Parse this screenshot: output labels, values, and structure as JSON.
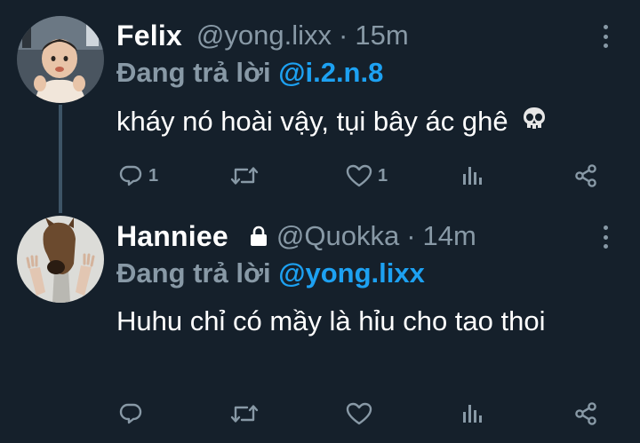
{
  "tweets": [
    {
      "name": "Felix",
      "handle": "@yong.lixx",
      "separator": "·",
      "time": "15m",
      "replying_prefix": "Đang trả lời",
      "replying_to": "@i.2.n.8",
      "text": "kháy nó hoài vậy, tụi bây ác ghê",
      "emoji": "💀",
      "reply_count": "1",
      "retweet_count": "",
      "like_count": "1",
      "locked": false,
      "avatar": "baby-photo"
    },
    {
      "name": "Hanniee",
      "handle": "@Quokka",
      "separator": "·",
      "time": "14m",
      "replying_prefix": "Đang trả lời",
      "replying_to": "@yong.lixx",
      "text": "Huhu chỉ có mầy là hỉu cho tao thoi",
      "reply_count": "",
      "retweet_count": "",
      "like_count": "",
      "locked": true,
      "avatar": "horse-mask-photo"
    }
  ],
  "colors": {
    "background": "#15202b",
    "text": "#ffffff",
    "muted": "#8899a6",
    "mention": "#1da1f2",
    "thread_line": "#3d5466"
  },
  "icons": [
    "reply-icon",
    "retweet-icon",
    "like-icon",
    "analytics-icon",
    "share-icon",
    "lock-icon",
    "more-icon",
    "skull-emoji"
  ]
}
